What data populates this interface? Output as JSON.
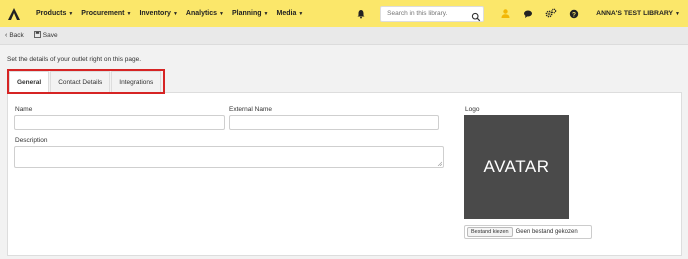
{
  "nav": {
    "items": [
      {
        "label": "Products"
      },
      {
        "label": "Procurement"
      },
      {
        "label": "Inventory"
      },
      {
        "label": "Analytics"
      },
      {
        "label": "Planning"
      },
      {
        "label": "Media"
      }
    ],
    "search_placeholder": "Search in this library.",
    "library_label": "ANNA'S TEST LIBRARY",
    "brand_color": "#fbe76a",
    "user_icon_color": "#f2b705"
  },
  "toolbar": {
    "back_label": "Back",
    "save_label": "Save"
  },
  "page": {
    "intro": "Set the details of your outlet right on this page."
  },
  "tabs": [
    {
      "label": "General",
      "active": true
    },
    {
      "label": "Contact Details",
      "active": false
    },
    {
      "label": "Integrations",
      "active": false
    }
  ],
  "form": {
    "name_label": "Name",
    "name_value": "",
    "external_name_label": "External Name",
    "external_name_value": "",
    "description_label": "Description",
    "description_value": "",
    "logo_label": "Logo",
    "avatar_text": "AVATAR",
    "file_button_label": "Bestand kiezen",
    "file_status": "Geen bestand gekozen"
  },
  "highlight_color": "#d62424"
}
